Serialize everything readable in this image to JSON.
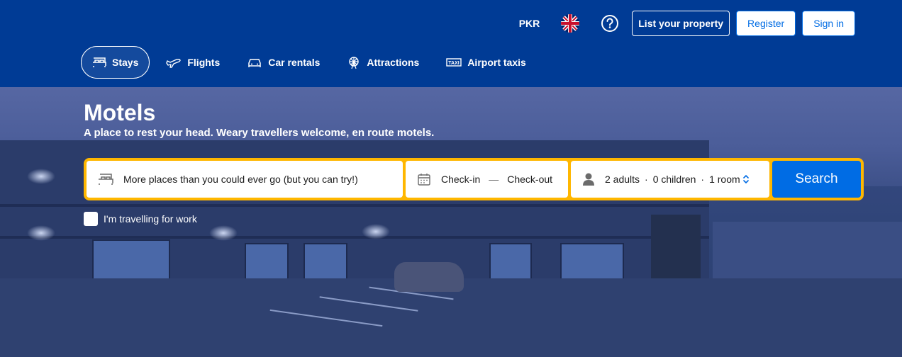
{
  "header": {
    "currency": "PKR",
    "language_icon": "uk-flag-icon",
    "help_icon": "question-circle-icon",
    "list_property": "List your property",
    "register": "Register",
    "sign_in": "Sign in"
  },
  "nav": {
    "items": [
      {
        "label": "Stays",
        "icon": "bed-icon",
        "active": true
      },
      {
        "label": "Flights",
        "icon": "plane-icon",
        "active": false
      },
      {
        "label": "Car rentals",
        "icon": "car-icon",
        "active": false
      },
      {
        "label": "Attractions",
        "icon": "ferris-wheel-icon",
        "active": false
      },
      {
        "label": "Airport taxis",
        "icon": "taxi-icon",
        "active": false
      }
    ]
  },
  "hero": {
    "title": "Motels",
    "subtitle": "A place to rest your head. Weary travellers welcome, en route motels."
  },
  "search": {
    "destination_placeholder": "More places than you could ever go (but you can try!)",
    "check_in": "Check-in",
    "dash": "—",
    "check_out": "Check-out",
    "adults": "2 adults",
    "children": "0 children",
    "rooms": "1 room",
    "separator": "·",
    "button": "Search",
    "work_label": "I'm travelling for work"
  },
  "colors": {
    "brand_blue": "#003b95",
    "accent_yellow": "#ffb700",
    "button_blue": "#006ce4"
  }
}
